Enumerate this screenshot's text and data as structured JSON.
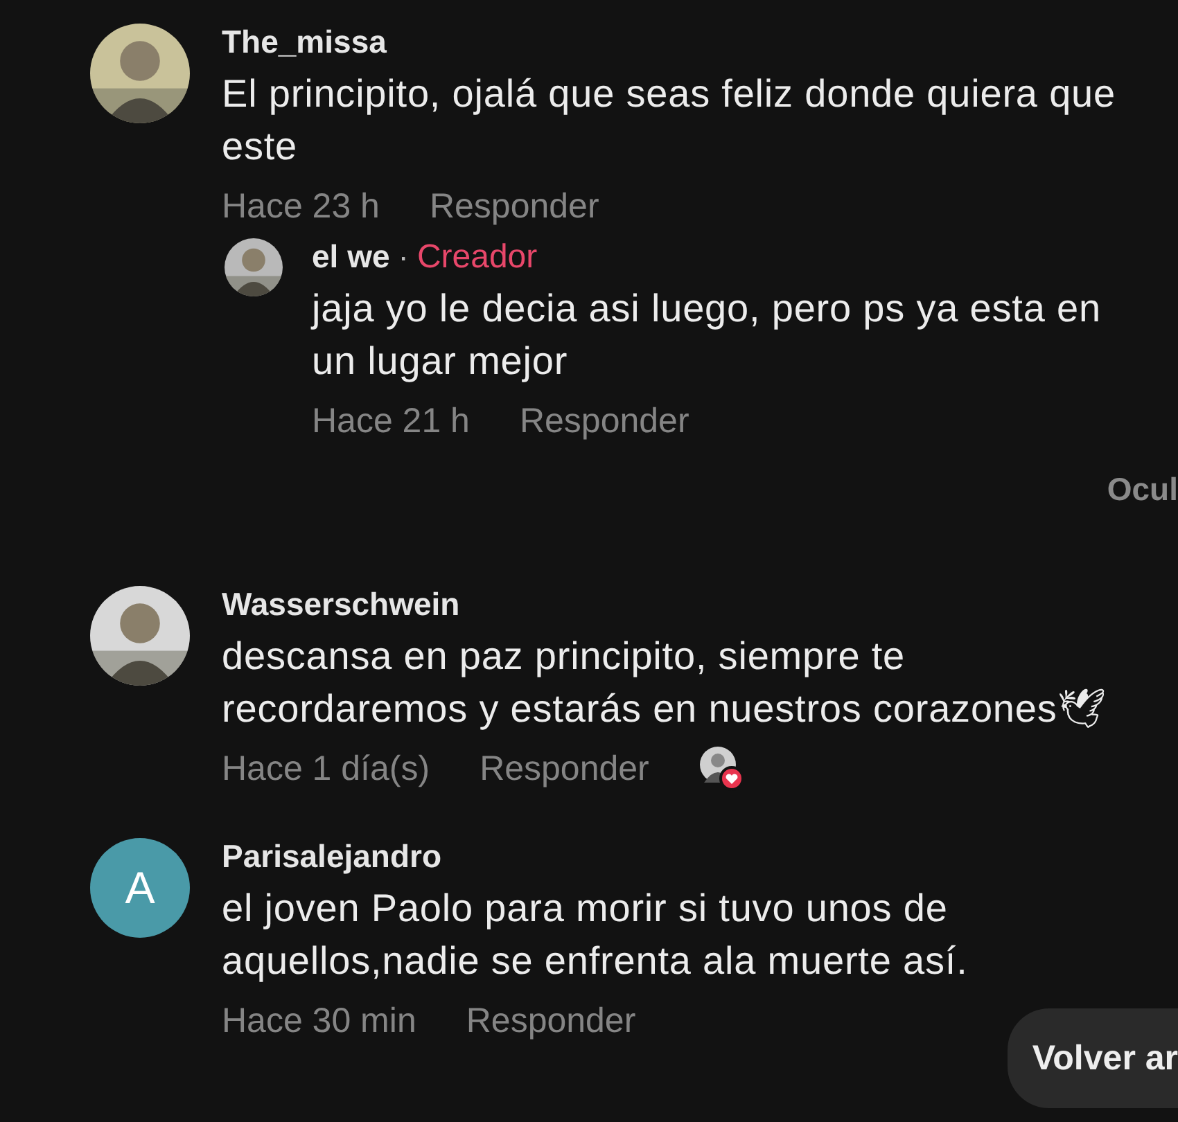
{
  "comments": [
    {
      "avatar": {
        "kind": "photo",
        "color": "#c9c29a"
      },
      "username": "The_missa",
      "text": "El principito, ojalá que seas feliz donde quiera que este",
      "time": "Hace 23 h",
      "reply_label": "Responder",
      "liked_by_creator": false,
      "replies": [
        {
          "avatar": {
            "kind": "photo",
            "color": "#b9b9b9"
          },
          "username": "el we",
          "separator": "·",
          "badge": "Creador",
          "text": "jaja yo le decia asi luego, pero ps ya esta en un lugar mejor",
          "time": "Hace 21 h",
          "reply_label": "Responder",
          "liked_by_creator": false
        }
      ],
      "hide_label": "Ocul"
    },
    {
      "avatar": {
        "kind": "photo",
        "color": "#d8d8d8"
      },
      "username": "Wasserschwein",
      "text": "descansa en paz principito, siempre te recordaremos y estarás en nuestros corazones🕊",
      "time": "Hace 1 día(s)",
      "reply_label": "Responder",
      "liked_by_creator": true
    },
    {
      "avatar": {
        "kind": "letter",
        "letter": "A",
        "color": "#4a9aa8"
      },
      "username": "Parisalejandro",
      "text": "el joven Paolo para morir si tuvo unos de aquellos,nadie se enfrenta ala muerte así.",
      "time": "Hace 30 min",
      "reply_label": "Responder",
      "liked_by_creator": false
    }
  ],
  "back_button": "Volver ar"
}
